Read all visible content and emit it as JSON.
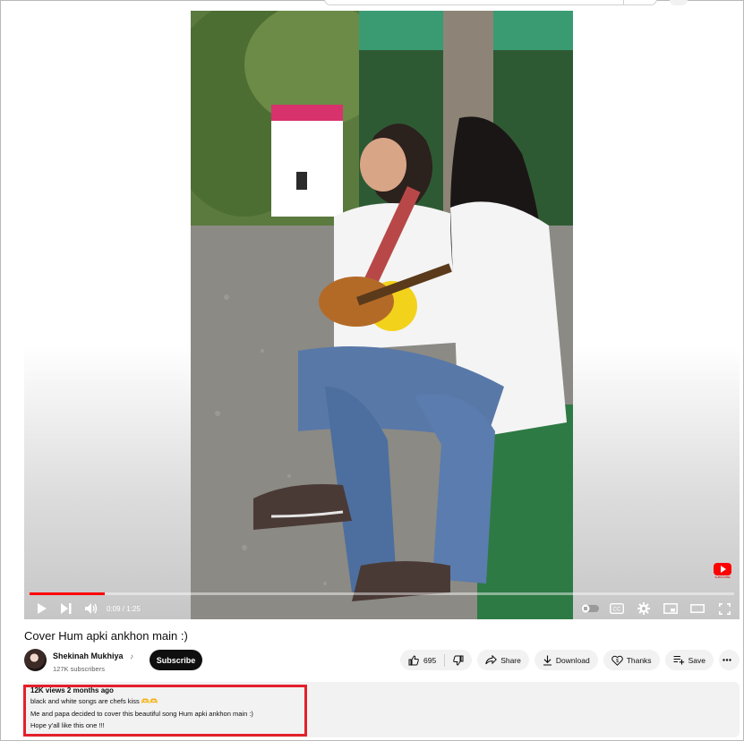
{
  "player": {
    "time": "0:09 / 1:25",
    "progress": 0.107,
    "icons": [
      "play-icon",
      "next-icon",
      "volume-icon",
      "autoplay-toggle-icon",
      "captions-icon",
      "settings-icon",
      "miniplayer-icon",
      "theater-icon",
      "fullscreen-icon"
    ]
  },
  "video": {
    "title": "Cover Hum apki ankhon main :)"
  },
  "channel": {
    "name": "Shekinah Mukhiya",
    "note_icon": "♪",
    "subscribers": "127K subscribers",
    "subscribe_label": "Subscribe"
  },
  "actions": {
    "like_count": "695",
    "share_label": "Share",
    "download_label": "Download",
    "thanks_label": "Thanks",
    "save_label": "Save"
  },
  "description": {
    "meta": "12K views  2 months ago",
    "line1": "black and white songs are chefs kiss 🫶🫶",
    "line2": "Me and papa decided to cover this beautiful song Hum apki ankhon main :)",
    "line3": "Hope y'all like this one !!!"
  },
  "colors": {
    "accent": "#ff0000",
    "highlight_box": "#e3202b",
    "pill_bg": "#f2f2f2",
    "subscribe_bg": "#0f0f0f"
  }
}
